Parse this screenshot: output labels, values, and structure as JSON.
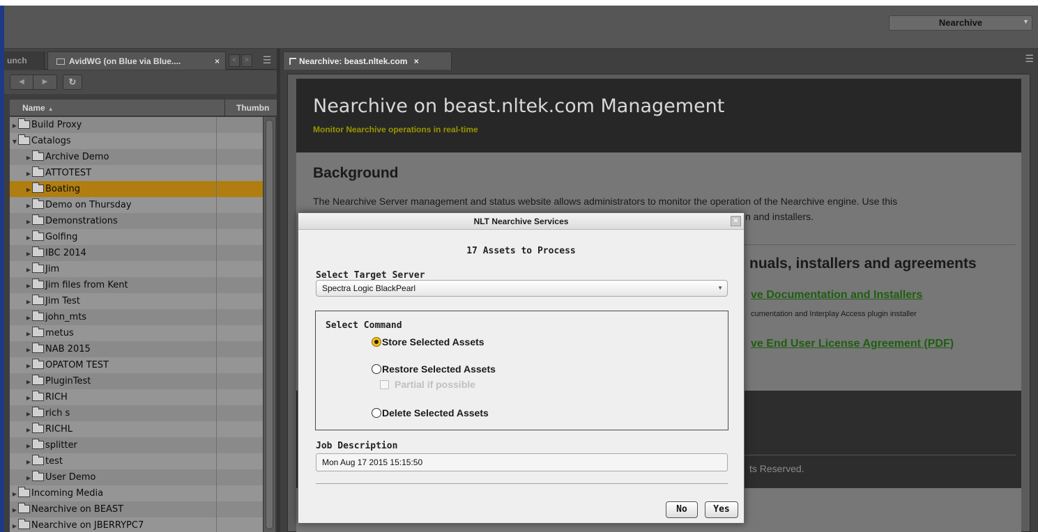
{
  "workspace": {
    "selected": "Nearchive"
  },
  "left_panel": {
    "tabs": [
      {
        "label": "unch"
      },
      {
        "label": "AvidWG (on Blue via Blue...."
      }
    ],
    "columns": {
      "name": "Name",
      "thumbnail": "Thumbn"
    },
    "tree": [
      {
        "label": "Build Proxy",
        "depth": 0,
        "expanded": false
      },
      {
        "label": "Catalogs",
        "depth": 0,
        "expanded": true
      },
      {
        "label": "Archive Demo",
        "depth": 1,
        "expanded": false
      },
      {
        "label": "ATTOTEST",
        "depth": 1,
        "expanded": false
      },
      {
        "label": "Boating",
        "depth": 1,
        "expanded": false,
        "selected": true
      },
      {
        "label": "Demo on Thursday",
        "depth": 1,
        "expanded": false
      },
      {
        "label": "Demonstrations",
        "depth": 1,
        "expanded": false
      },
      {
        "label": "Golfing",
        "depth": 1,
        "expanded": false
      },
      {
        "label": "IBC 2014",
        "depth": 1,
        "expanded": false
      },
      {
        "label": "Jim",
        "depth": 1,
        "expanded": false
      },
      {
        "label": "Jim files from Kent",
        "depth": 1,
        "expanded": false
      },
      {
        "label": "Jim Test",
        "depth": 1,
        "expanded": false
      },
      {
        "label": "john_mts",
        "depth": 1,
        "expanded": false
      },
      {
        "label": "metus",
        "depth": 1,
        "expanded": false
      },
      {
        "label": "NAB 2015",
        "depth": 1,
        "expanded": false
      },
      {
        "label": "OPATOM TEST",
        "depth": 1,
        "expanded": false
      },
      {
        "label": "PluginTest",
        "depth": 1,
        "expanded": false
      },
      {
        "label": "RICH",
        "depth": 1,
        "expanded": false
      },
      {
        "label": "rich s",
        "depth": 1,
        "expanded": false
      },
      {
        "label": "RICHL",
        "depth": 1,
        "expanded": false
      },
      {
        "label": "splitter",
        "depth": 1,
        "expanded": false
      },
      {
        "label": "test",
        "depth": 1,
        "expanded": false
      },
      {
        "label": "User Demo",
        "depth": 1,
        "expanded": false
      },
      {
        "label": "Incoming Media",
        "depth": 0,
        "expanded": false
      },
      {
        "label": "Nearchive on BEAST",
        "depth": 0,
        "expanded": false
      },
      {
        "label": "Nearchive on JBERRYPC7",
        "depth": 0,
        "expanded": false
      }
    ]
  },
  "right_panel": {
    "tab_label": "Nearchive: beast.nltek.com",
    "page": {
      "title": "Nearchive on beast.nltek.com Management",
      "subtitle": "Monitor Nearchive operations in real-time",
      "background_heading": "Background",
      "background_text_line1": "The Nearchive Server management and status website allows administrators to monitor the operation of the Nearchive engine. Use this",
      "background_text_line2_visible": "n and installers.",
      "docs_heading_visible": "nuals, installers and agreements",
      "docs_link1_visible": "ve Documentation and Installers",
      "docs_note_visible": "cumentation and Interplay Access plugin installer",
      "docs_link2_visible": "ve End User License Agreement (PDF)",
      "footer_visible": "ts Reserved."
    }
  },
  "dialog": {
    "title": "NLT Nearchive Services",
    "asset_count_text": "17 Assets to Process",
    "target_label": "Select Target Server",
    "target_value": "Spectra Logic BlackPearl",
    "command_label": "Select Command",
    "commands": [
      {
        "label": "Store Selected Assets",
        "selected": true
      },
      {
        "label": "Restore Selected Assets",
        "selected": false
      },
      {
        "label": "Delete Selected Assets",
        "selected": false
      }
    ],
    "partial_label": "Partial if possible",
    "partial_checked": false,
    "job_label": "Job Description",
    "job_value": "Mon Aug 17 2015 15:15:50",
    "no_label": "No",
    "yes_label": "Yes"
  },
  "colors": {
    "selection": "#b07e10",
    "hero_subtitle": "#9a9400",
    "link": "#1f5e10",
    "radio_selected": "#f2c21a"
  }
}
